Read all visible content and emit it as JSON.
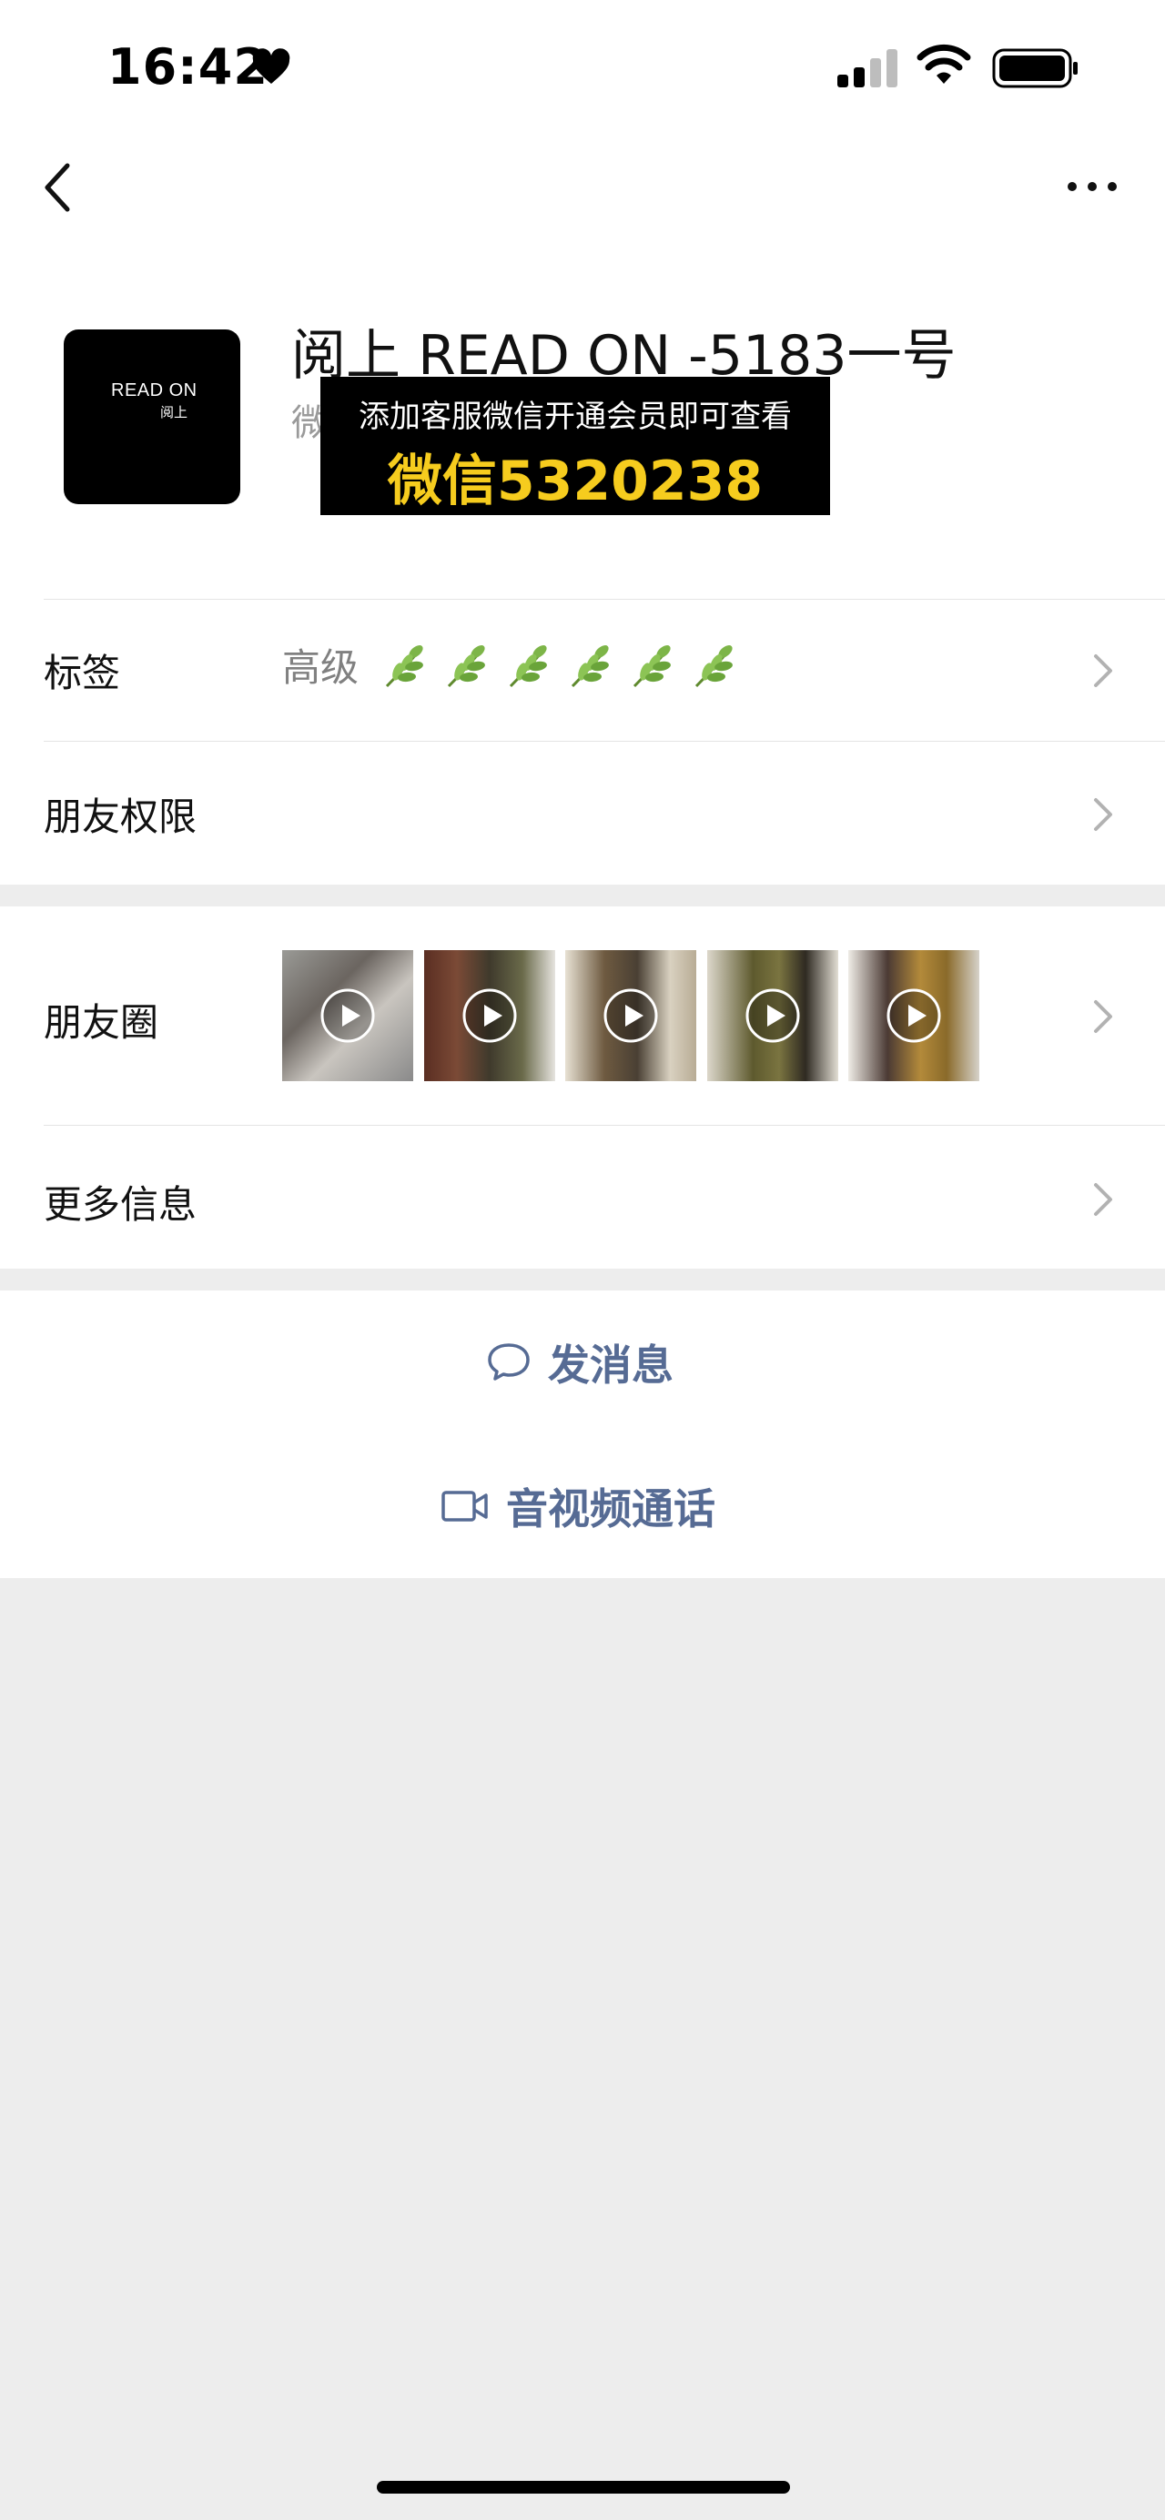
{
  "status_bar": {
    "time": "16:42"
  },
  "profile": {
    "name": "阅上 READ ON -5183一号",
    "wechat_id_prefix": "微",
    "avatar_line1": "READ ON",
    "avatar_line2": "阅上"
  },
  "overlay": {
    "line1": "添加客服微信开通会员即可查看",
    "line2": "微信5320238"
  },
  "rows": {
    "tags": {
      "label": "标签",
      "value": "高级",
      "leaf_count": 6
    },
    "permissions": {
      "label": "朋友权限"
    },
    "moments": {
      "label": "朋友圈"
    },
    "more_info": {
      "label": "更多信息"
    }
  },
  "actions": {
    "message": "发消息",
    "call": "音视频通话"
  },
  "colors": {
    "link": "#566b94",
    "overlay_highlight": "#f6cc1e",
    "background": "#ededed"
  }
}
